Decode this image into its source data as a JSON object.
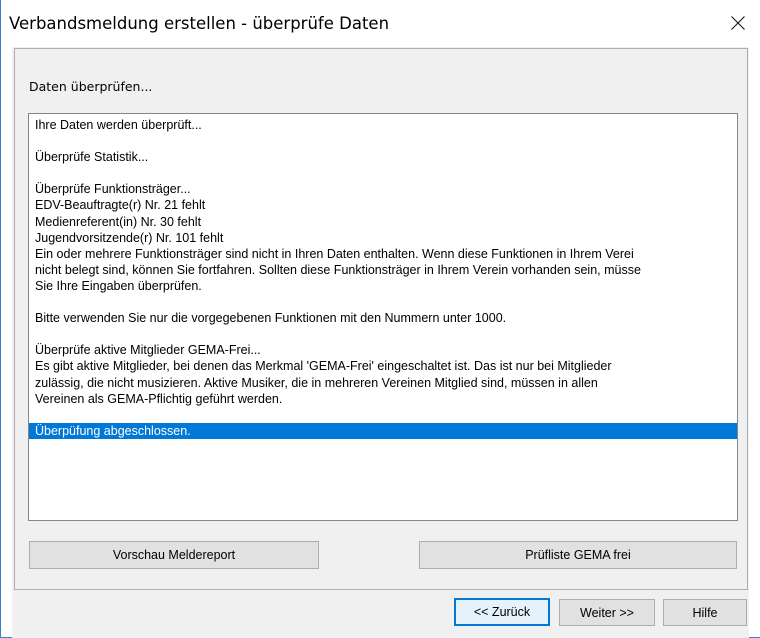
{
  "window": {
    "title": "Verbandsmeldung erstellen - überprüfe Daten",
    "close_icon": "close-icon"
  },
  "group": {
    "caption": "Daten überprüfen..."
  },
  "log": {
    "lines": [
      "Ihre Daten werden überprüft...",
      "",
      "Überprüfe Statistik...",
      "",
      "Überprüfe Funktionsträger...",
      "EDV-Beauftragte(r) Nr. 21 fehlt",
      "Medienreferent(in) Nr. 30 fehlt",
      "Jugendvorsitzende(r) Nr. 101 fehlt",
      "Ein oder mehrere Funktionsträger sind nicht in Ihren Daten enthalten. Wenn diese Funktionen in Ihrem Verei",
      "nicht belegt sind, können Sie fortfahren. Sollten diese Funktionsträger in Ihrem Verein vorhanden sein, müsse",
      "Sie Ihre Eingaben überprüfen.",
      "",
      "Bitte verwenden Sie nur die vorgegebenen Funktionen mit den Nummern unter 1000.",
      "",
      "Überprüfe aktive Mitglieder GEMA-Frei...",
      "Es gibt aktive Mitglieder, bei denen das Merkmal 'GEMA-Frei' eingeschaltet ist. Das ist nur bei Mitglieder",
      "zulässig, die nicht musizieren. Aktive Musiker, die in mehreren Vereinen Mitglied sind, müssen in allen",
      "Vereinen als GEMA-Pflichtig geführt werden.",
      "",
      "Überpüfung abgeschlossen."
    ],
    "selected_index": 19
  },
  "buttons": {
    "preview": "Vorschau Meldereport",
    "gema_list": "Prüfliste GEMA frei",
    "back": "<< Zurück",
    "next": "Weiter >>",
    "help": "Hilfe"
  },
  "colors": {
    "selection": "#0078d7",
    "window_border": "#3b7fc4",
    "client_bg": "#f0f0f0"
  }
}
